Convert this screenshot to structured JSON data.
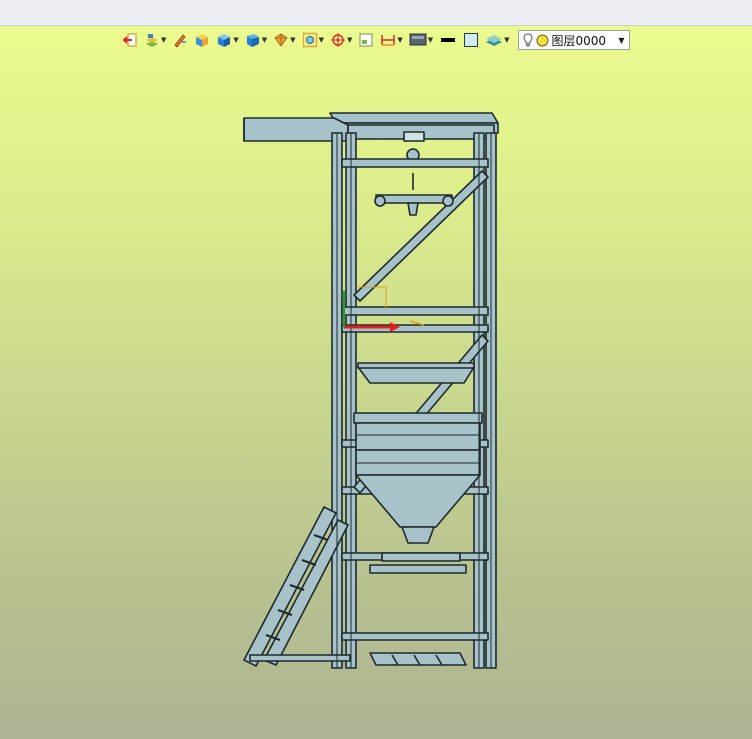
{
  "window": {
    "title": ""
  },
  "toolbar": {
    "tools": [
      {
        "name": "return-icon",
        "dropdown": false
      },
      {
        "name": "layers-tool-icon",
        "dropdown": true
      },
      {
        "name": "pencil-edit-icon",
        "dropdown": false
      },
      {
        "name": "solid-cube-icon",
        "dropdown": false
      },
      {
        "name": "shaded-cube-icon",
        "dropdown": true
      },
      {
        "name": "view-cube-icon",
        "dropdown": true
      },
      {
        "name": "section-view-icon",
        "dropdown": true
      },
      {
        "name": "zoom-fit-icon",
        "dropdown": true
      },
      {
        "name": "pivot-target-icon",
        "dropdown": true
      },
      {
        "name": "window-view-icon",
        "dropdown": false
      },
      {
        "name": "dimension-icon",
        "dropdown": true
      },
      {
        "name": "render-mode-icon",
        "dropdown": true
      },
      {
        "name": "line-color-icon",
        "dropdown": false
      },
      {
        "name": "fill-color-icon",
        "dropdown": false
      },
      {
        "name": "layer-stack-icon",
        "dropdown": true
      }
    ],
    "layer_selector": {
      "name": "图层0000",
      "bulb_icon": "lightbulb-icon",
      "color_icon": "yellow-circle-icon"
    }
  },
  "colors": {
    "background_top": "#ebfb8e",
    "background_bottom": "#aeb494",
    "steel": "#a7c3c9",
    "outline": "#1c2a2e",
    "axis_x": "#e02020",
    "axis_y": "#2aa02a",
    "axis_z": "#e0a020"
  },
  "model": {
    "description": ""
  }
}
